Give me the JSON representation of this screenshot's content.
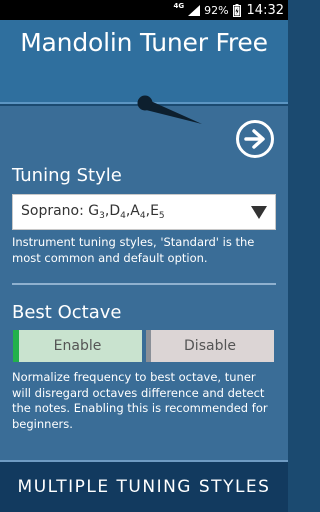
{
  "status_bar": {
    "network": "4G",
    "battery": "92%",
    "time": "14:32"
  },
  "header": {
    "title": "Mandolin Tuner Free"
  },
  "tuning": {
    "section_title": "Tuning Style",
    "selected_prefix": "Soprano: ",
    "notes": [
      {
        "note": "G",
        "octave": "3"
      },
      {
        "note": "D",
        "octave": "4"
      },
      {
        "note": "A",
        "octave": "4"
      },
      {
        "note": "E",
        "octave": "5"
      }
    ],
    "hint": "Instrument tuning styles, 'Standard' is the most common and default option."
  },
  "octave": {
    "section_title": "Best Octave",
    "enable_label": "Enable",
    "disable_label": "Disable",
    "selected": "Enable",
    "hint": "Normalize frequency to best octave, tuner will disregard octaves difference and detect the notes. Enabling this is recommended for beginners."
  },
  "banner": {
    "text": "MULTIPLE TUNING STYLES"
  },
  "colors": {
    "header": "#2f6f9e",
    "main": "#3a6d97",
    "banner": "#123a5f",
    "enable_accent": "#22b14c",
    "enable_bg": "#c9e3cf",
    "disable_bg": "#dcd5d5"
  },
  "icons": {
    "next": "arrow-right-circle-icon",
    "dropdown": "triangle-down-icon",
    "needle": "tuner-needle-icon"
  }
}
